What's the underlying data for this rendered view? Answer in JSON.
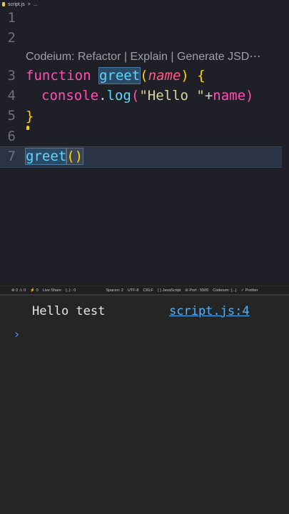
{
  "breadcrumb": {
    "file": "script.js",
    "sep": ">",
    "more": "..."
  },
  "line_numbers": [
    "1",
    "2",
    "3",
    "4",
    "5",
    "6",
    "7"
  ],
  "codelens": "Codeium: Refactor | Explain | Generate JSD⋯",
  "code": {
    "l3_kw": "function",
    "l3_fn": "greet",
    "l3_open": "(",
    "l3_param": "name",
    "l3_close": ")",
    "l3_brace": " {",
    "l4_console": "console",
    "l4_dot": ".",
    "l4_log": "log",
    "l4_open": "(",
    "l4_str": "\"Hello \"",
    "l4_plus": "+",
    "l4_name": "name",
    "l4_close": ")",
    "l5_brace": "}",
    "l7_fn": "greet",
    "l7_parens": "()"
  },
  "status": {
    "problems": "⊗ 0 ⚠ 0",
    "ports": "⚡ 0",
    "live_share": "Live Share",
    "braces": "{..} : 0",
    "spaces": "Spaces: 2",
    "encoding": "UTF-8",
    "eol": "CRLF",
    "language": "{ } JavaScript",
    "port": "⊘ Port : 5500",
    "codeium": "Codeium: {...}",
    "prettier": "✓ Prettier"
  },
  "console": {
    "output": "Hello test",
    "source": "script.js:4",
    "prompt": "›"
  }
}
